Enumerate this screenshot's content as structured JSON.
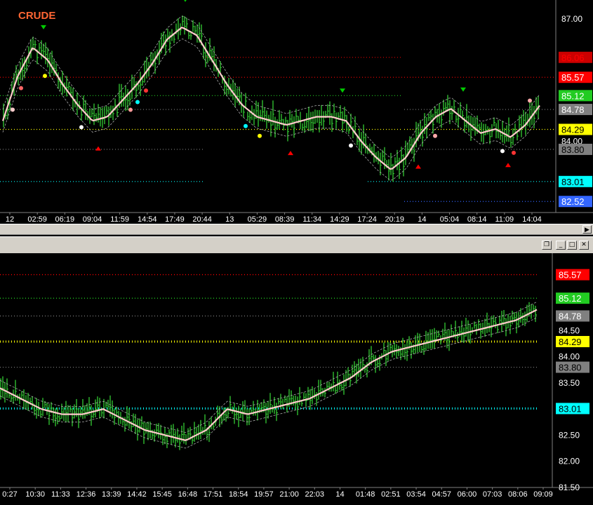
{
  "top_chart": {
    "title": "CRUDE",
    "title_color": "#ff6633",
    "price_scale": [
      "87.00",
      "84.00"
    ],
    "price_tags": [
      {
        "label": "86.06",
        "bg": "#cc0000",
        "fg": "#ff0000"
      },
      {
        "label": "85.57",
        "bg": "#ff0000",
        "fg": "#ffffff"
      },
      {
        "label": "85.12",
        "bg": "#22cc22",
        "fg": "#ffffff"
      },
      {
        "label": "84.78",
        "bg": "#808080",
        "fg": "#ffffff"
      },
      {
        "label": "84.29",
        "bg": "#ffff00",
        "fg": "#000000"
      },
      {
        "label": "83.80",
        "bg": "#808080",
        "fg": "#000000"
      },
      {
        "label": "83.01",
        "bg": "#00ffff",
        "fg": "#000000"
      },
      {
        "label": "82.52",
        "bg": "#3366ff",
        "fg": "#ffffff"
      }
    ],
    "time_labels": [
      "12",
      "02:59",
      "06:19",
      "09:04",
      "11:59",
      "14:54",
      "17:49",
      "20:44",
      "13",
      "05:29",
      "08:39",
      "11:34",
      "14:29",
      "17:24",
      "20:19",
      "14",
      "05:04",
      "08:14",
      "11:09",
      "14:04"
    ]
  },
  "bottom_chart": {
    "price_scale": [
      "84.50",
      "84.00",
      "83.50",
      "82.50",
      "82.00",
      "81.50"
    ],
    "price_tags": [
      {
        "label": "85.57",
        "bg": "#ff0000",
        "fg": "#ffffff"
      },
      {
        "label": "85.12",
        "bg": "#22cc22",
        "fg": "#ffffff"
      },
      {
        "label": "84.78",
        "bg": "#808080",
        "fg": "#ffffff"
      },
      {
        "label": "84.29",
        "bg": "#ffff00",
        "fg": "#000000"
      },
      {
        "label": "83.80",
        "bg": "#808080",
        "fg": "#000000"
      },
      {
        "label": "83.01",
        "bg": "#00ffff",
        "fg": "#000000"
      }
    ],
    "time_labels": [
      "0:27",
      "10:30",
      "11:33",
      "12:36",
      "13:39",
      "14:42",
      "15:45",
      "16:48",
      "17:51",
      "18:54",
      "19:57",
      "21:00",
      "22:03",
      "14",
      "01:48",
      "02:51",
      "03:54",
      "04:57",
      "06:00",
      "07:03",
      "08:06",
      "09:09"
    ]
  },
  "window_controls": {
    "restore": "❐",
    "minimize": "_",
    "maximize": "□",
    "close": "✕"
  },
  "scroll_arrow": "▶",
  "colors": {
    "bars": "#33cc33",
    "ma": "#ffcccc",
    "band": "#aaaaaa",
    "up_arrow": "#ff0000",
    "down_arrow": "#00cc00"
  },
  "chart_data": [
    {
      "type": "line",
      "title": "CRUDE",
      "ylim": [
        82.3,
        87.4
      ],
      "levels": [
        86.06,
        85.57,
        85.12,
        84.78,
        84.29,
        83.8,
        83.01,
        82.52
      ],
      "series": [
        {
          "values": [
            84.5,
            85.6,
            86.3,
            86.0,
            85.4,
            84.9,
            84.5,
            84.6,
            85.0,
            85.4,
            85.9,
            86.5,
            86.8,
            86.6,
            86.0,
            85.4,
            84.9,
            84.6,
            84.5,
            84.4,
            84.5,
            84.6,
            84.6,
            84.5,
            84.0,
            83.6,
            83.3,
            83.6,
            84.2,
            84.6,
            84.8,
            84.5,
            84.2,
            84.3,
            84.1,
            84.4,
            84.9
          ]
        }
      ]
    },
    {
      "type": "line",
      "ylim": [
        81.5,
        85.9
      ],
      "levels": [
        85.57,
        85.12,
        84.78,
        84.29,
        83.8,
        83.01
      ],
      "series": [
        {
          "values": [
            83.4,
            83.2,
            83.0,
            82.9,
            82.9,
            83.0,
            82.8,
            82.6,
            82.5,
            82.4,
            82.6,
            83.0,
            82.9,
            83.0,
            83.1,
            83.2,
            83.4,
            83.6,
            83.9,
            84.1,
            84.2,
            84.3,
            84.4,
            84.5,
            84.6,
            84.7,
            84.9
          ]
        }
      ]
    }
  ]
}
